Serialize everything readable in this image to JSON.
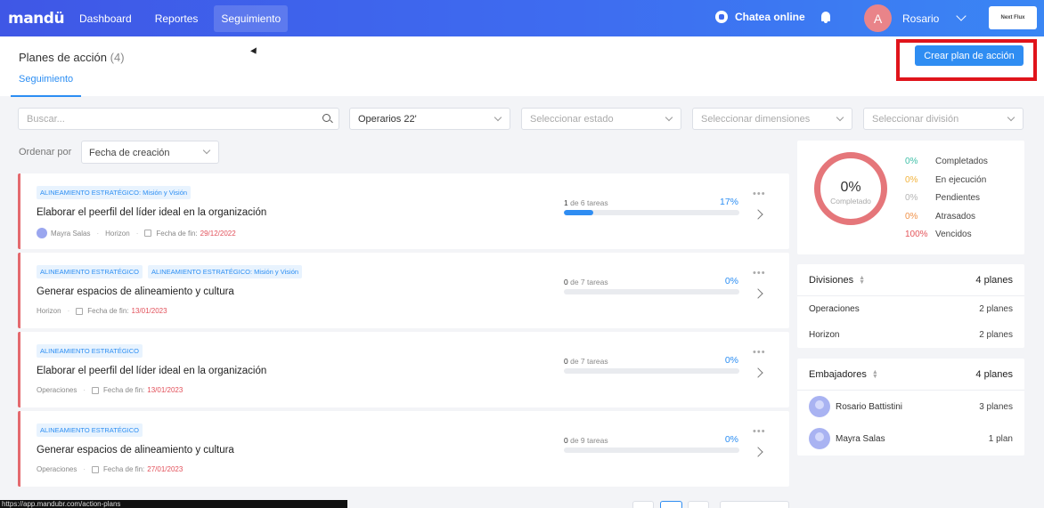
{
  "nav": {
    "brand": "mandü",
    "links": [
      "Dashboard",
      "Reportes",
      "Seguimiento"
    ],
    "chat": "Chatea online",
    "avatar_letter": "A",
    "user": "Rosario",
    "next_label": "Next Flux"
  },
  "header": {
    "title": "Planes de acción",
    "count": "(4)",
    "tab": "Seguimiento",
    "create_button": "Crear plan de acción"
  },
  "filters": {
    "search_placeholder": "Buscar...",
    "group": "Operarios 22'",
    "estado": "Seleccionar estado",
    "dimensiones": "Seleccionar dimensiones",
    "division": "Seleccionar división"
  },
  "sort": {
    "label": "Ordenar por",
    "value": "Fecha de creación"
  },
  "plans": [
    {
      "tags": [
        "ALINEAMIENTO ESTRATÉGICO: Misión y Visión"
      ],
      "title": "Elaborar el peerfil del líder ideal en la organización",
      "owner": "Mayra Salas",
      "division": "Horizon",
      "due_label": "Fecha de fin:",
      "due": "29/12/2022",
      "done": "1",
      "total_label": "de 6 tareas",
      "percent": "17%",
      "progress": 0.17
    },
    {
      "tags": [
        "ALINEAMIENTO ESTRATÉGICO",
        "ALINEAMIENTO ESTRATÉGICO: Misión y Visión"
      ],
      "title": "Generar espacios de alineamiento y cultura",
      "owner": "",
      "division": "Horizon",
      "due_label": "Fecha de fin:",
      "due": "13/01/2023",
      "done": "0",
      "total_label": "de 7 tareas",
      "percent": "0%",
      "progress": 0
    },
    {
      "tags": [
        "ALINEAMIENTO ESTRATÉGICO"
      ],
      "title": "Elaborar el peerfil del líder ideal en la organización",
      "owner": "",
      "division": "Operaciones",
      "due_label": "Fecha de fin:",
      "due": "13/01/2023",
      "done": "0",
      "total_label": "de 7 tareas",
      "percent": "0%",
      "progress": 0
    },
    {
      "tags": [
        "ALINEAMIENTO ESTRATÉGICO"
      ],
      "title": "Generar espacios de alineamiento y cultura",
      "owner": "",
      "division": "Operaciones",
      "due_label": "Fecha de fin:",
      "due": "27/01/2023",
      "done": "0",
      "total_label": "de 9 tareas",
      "percent": "0%",
      "progress": 0
    }
  ],
  "summary": {
    "percent": "0%",
    "label": "Completado",
    "legend": [
      {
        "value": "0%",
        "label": "Completados",
        "color": "#3fbfa7"
      },
      {
        "value": "0%",
        "label": "En ejecución",
        "color": "#f2b33d"
      },
      {
        "value": "0%",
        "label": "Pendientes",
        "color": "#b5b5b5"
      },
      {
        "value": "0%",
        "label": "Atrasados",
        "color": "#f0924a"
      },
      {
        "value": "100%",
        "label": "Vencidos",
        "color": "#e4555b"
      }
    ]
  },
  "divisions": {
    "title": "Divisiones",
    "total": "4 planes",
    "rows": [
      {
        "name": "Operaciones",
        "count": "2 planes"
      },
      {
        "name": "Horizon",
        "count": "2 planes"
      }
    ]
  },
  "ambassadors": {
    "title": "Embajadores",
    "total": "4 planes",
    "rows": [
      {
        "name": "Rosario Battistini",
        "count": "3 planes"
      },
      {
        "name": "Mayra Salas",
        "count": "1 plan"
      }
    ]
  },
  "status_url": "https://app.mandubr.com/action-plans",
  "colors": {
    "accent": "#2f8df2",
    "overdue": "#e4555b",
    "highlight": "#e0141b"
  }
}
